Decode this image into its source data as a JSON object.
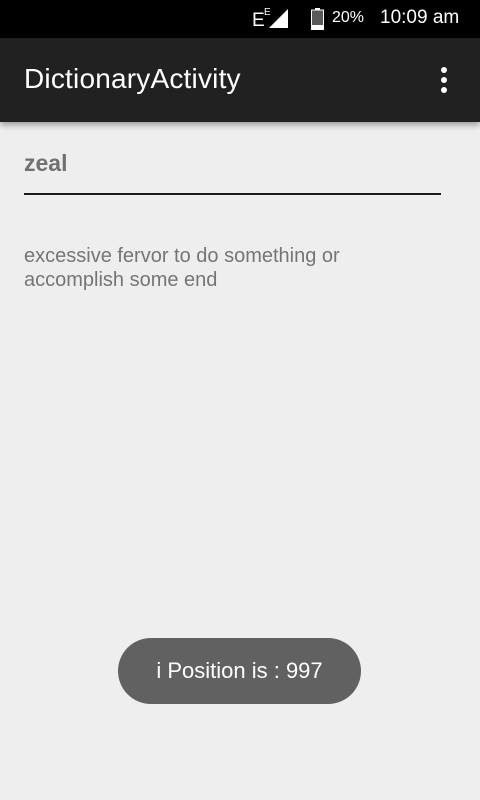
{
  "status_bar": {
    "network_icon": "signal-e-icon",
    "network_label": "E",
    "battery_icon": "battery-icon",
    "battery_percent": "20%",
    "time": "10:09 am"
  },
  "app_bar": {
    "title": "DictionaryActivity",
    "overflow_icon": "more-vert-icon",
    "background_color": "#212121"
  },
  "word_field": {
    "value": "zeal"
  },
  "definition": {
    "text": "excessive fervor to do something or accomplish some end"
  },
  "toast": {
    "message": "i Position is : 997"
  }
}
